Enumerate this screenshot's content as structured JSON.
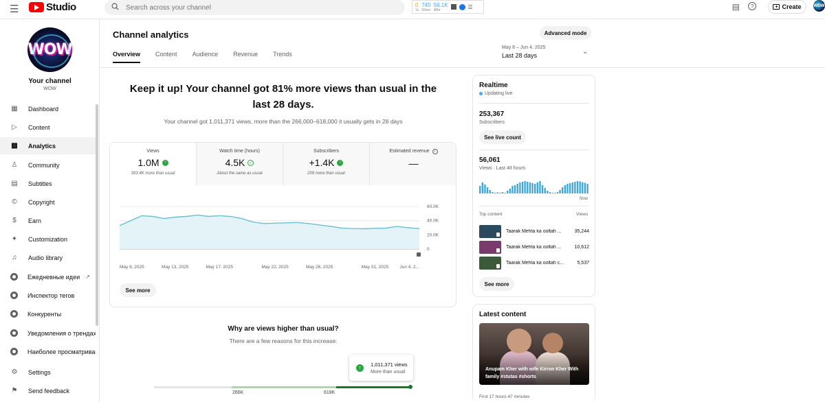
{
  "topbar": {
    "logo_text": "Studio",
    "search_placeholder": "Search across your channel",
    "ext": {
      "v1": "0",
      "v1_sub": "1s",
      "v2": "745",
      "v2_sub": "60sec",
      "v3": "56.1K",
      "v3_sub": "48hr"
    },
    "create_label": "Create",
    "avatar_text": "WOW"
  },
  "channel": {
    "name": "Your channel",
    "handle": "WOW",
    "avatar_text": "WOW"
  },
  "sidebar": {
    "items": [
      {
        "label": "Dashboard",
        "icon": "dashboard-icon"
      },
      {
        "label": "Content",
        "icon": "content-icon"
      },
      {
        "label": "Analytics",
        "icon": "analytics-icon"
      },
      {
        "label": "Community",
        "icon": "community-icon"
      },
      {
        "label": "Subtitles",
        "icon": "subtitles-icon"
      },
      {
        "label": "Copyright",
        "icon": "copyright-icon"
      },
      {
        "label": "Earn",
        "icon": "earn-icon"
      },
      {
        "label": "Customization",
        "icon": "customization-icon"
      },
      {
        "label": "Audio library",
        "icon": "audio-library-icon"
      },
      {
        "label": "Ежедневные идеи",
        "icon": "extension-icon"
      },
      {
        "label": "Инспектор тегов",
        "icon": "extension-icon"
      },
      {
        "label": "Конкуренты",
        "icon": "extension-icon"
      },
      {
        "label": "Уведомления о трендах",
        "icon": "extension-icon"
      },
      {
        "label": "Наиболее просматриваемые",
        "icon": "extension-icon"
      },
      {
        "label": "Settings",
        "icon": "settings-icon"
      },
      {
        "label": "Send feedback",
        "icon": "feedback-icon"
      }
    ]
  },
  "header": {
    "title": "Channel analytics",
    "advanced_label": "Advanced mode",
    "tabs": [
      "Overview",
      "Content",
      "Audience",
      "Revenue",
      "Trends"
    ],
    "date_sub": "May 8 – Jun 4, 2025",
    "date_main": "Last 28 days"
  },
  "overview": {
    "headline": "Keep it up! Your channel got 81% more views than usual in the last 28 days.",
    "subline": "Your channel got 1,011,371 views, more than the 266,000–618,000 it usually gets in 28 days",
    "metrics": [
      {
        "label": "Views",
        "value": "1.0M",
        "note": "393.4K more than usual"
      },
      {
        "label": "Watch time (hours)",
        "value": "4.5K",
        "note": "About the same as usual"
      },
      {
        "label": "Subscribers",
        "value": "+1.4K",
        "note": "209 more than usual"
      },
      {
        "label": "Estimated revenue",
        "value": "—",
        "note": ""
      }
    ],
    "see_more_label": "See more"
  },
  "chart_data": {
    "type": "area",
    "x": [
      "May 8, 2025",
      "May 9",
      "May 10",
      "May 11",
      "May 12",
      "May 13, 2025",
      "May 14",
      "May 15",
      "May 16",
      "May 17, 2025",
      "May 18",
      "May 19",
      "May 20",
      "May 21",
      "May 22, 2025",
      "May 23",
      "May 24",
      "May 25",
      "May 26, 2025",
      "May 27",
      "May 28",
      "May 29",
      "May 30",
      "May 31, 2025",
      "Jun 1",
      "Jun 2",
      "Jun 3",
      "Jun 4, 2025"
    ],
    "values": [
      33000,
      40000,
      47000,
      46000,
      43000,
      45000,
      46000,
      48000,
      46000,
      47000,
      46000,
      43000,
      38000,
      36000,
      36500,
      37000,
      37500,
      36000,
      34000,
      32000,
      29500,
      28800,
      28500,
      29200,
      29500,
      31800,
      30000,
      28800
    ],
    "x_tick_labels": [
      "May 8, 2025",
      "May 13, 2025",
      "May 17, 2025",
      "May 22, 2025",
      "May 26, 2025",
      "May 31, 2025",
      "Jun 4, 2..."
    ],
    "y_ticks": [
      "60.0K",
      "40.0K",
      "20.0K",
      "0"
    ],
    "ylim": [
      0,
      60000
    ],
    "line_color": "#69c0d6",
    "fill_color": "#e3f3f8"
  },
  "why": {
    "title": "Why are views higher than usual?",
    "subtitle": "There are a few reasons for this increase:",
    "low_label": "266K",
    "high_label": "618K",
    "tooltip_value": "1,011,371 views",
    "tooltip_note": "More than usual"
  },
  "realtime": {
    "title": "Realtime",
    "live_label": "Updating live",
    "subs_value": "253,367",
    "subs_label": "Subscribers",
    "live_count_label": "See live count",
    "views_value": "56,061",
    "views_label": "Views · Last 48 hours",
    "now_label": "Now",
    "bars": [
      0.55,
      0.8,
      0.65,
      0.45,
      0.25,
      0.1,
      0.05,
      0.08,
      0.05,
      0.1,
      0.05,
      0.2,
      0.35,
      0.55,
      0.6,
      0.7,
      0.8,
      0.85,
      0.9,
      0.85,
      0.8,
      0.75,
      0.7,
      0.8,
      0.9,
      0.6,
      0.4,
      0.2,
      0.1,
      0.05,
      0.05,
      0.1,
      0.25,
      0.45,
      0.6,
      0.7,
      0.75,
      0.8,
      0.85,
      0.9,
      0.88,
      0.82,
      0.78,
      0.7
    ],
    "top_content_label": "Top content",
    "views_header": "Views",
    "top": [
      {
        "title": "Taarak Mehta ka ooltah ...",
        "views": "35,244",
        "color": "#2b4a5e"
      },
      {
        "title": "Taarak Mehta ka ooltah ...",
        "views": "10,612",
        "color": "#7a3a6e"
      },
      {
        "title": "Taarak Mehta ka ooltah c...",
        "views": "5,537",
        "color": "#3a5a3a"
      }
    ],
    "see_more_label": "See more"
  },
  "latest": {
    "title": "Latest content",
    "caption": "Anupam Kher with wife Kirron Kher With family #stutas #shorts",
    "time": "First 17 hours 47 minutes"
  }
}
